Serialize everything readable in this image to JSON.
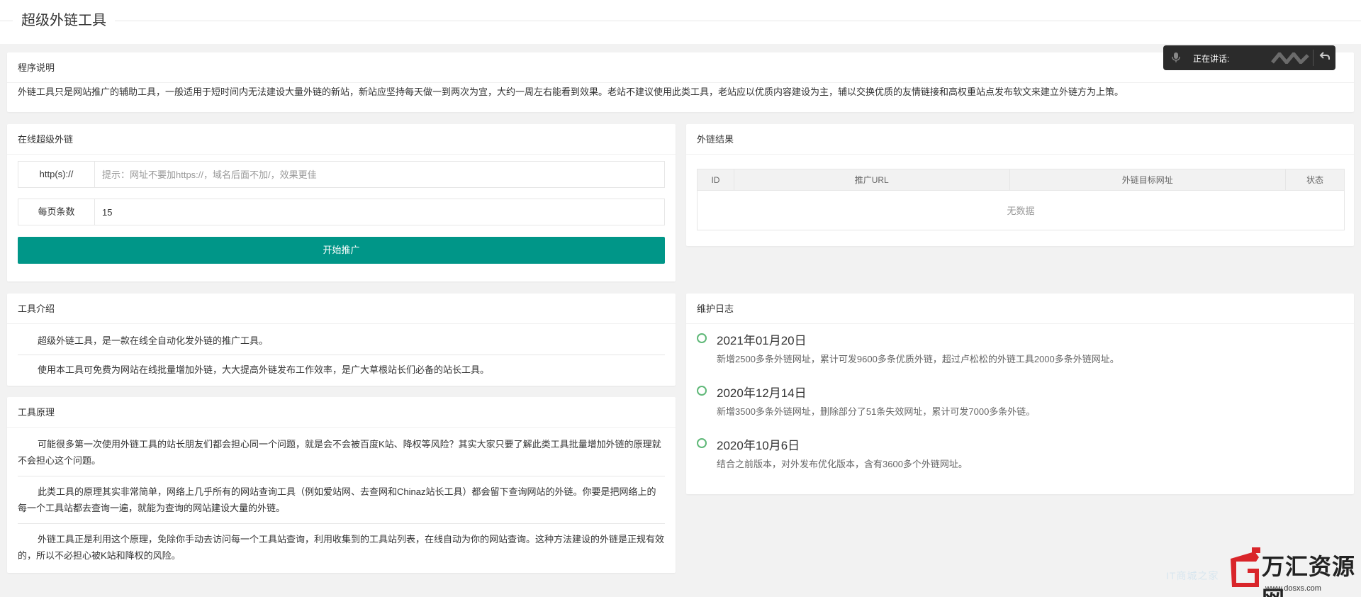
{
  "header": {
    "title": "超级外链工具"
  },
  "program_desc": {
    "title": "程序说明",
    "text": "外链工具只是网站推广的辅助工具，一般适用于短时间内无法建设大量外链的新站，新站应坚持每天做一到两次为宜，大约一周左右能看到效果。老站不建议使用此类工具，老站应以优质内容建设为主，辅以交换优质的友情链接和高权重站点发布软文来建立外链方为上策。"
  },
  "online_form": {
    "title": "在线超级外链",
    "url_label": "http(s)://",
    "url_placeholder": "提示：网址不要加https://，域名后面不加/，效果更佳",
    "url_value": "",
    "per_page_label": "每页条数",
    "per_page_value": "15",
    "submit_label": "开始推广",
    "accent_color": "#009688"
  },
  "results": {
    "title": "外链结果",
    "columns": [
      "ID",
      "推广URL",
      "外链目标网址",
      "状态"
    ],
    "empty_text": "无数据"
  },
  "tool_intro": {
    "title": "工具介绍",
    "paragraphs": [
      "超级外链工具，是一款在线全自动化发外链的推广工具。",
      "使用本工具可免费为网站在线批量增加外链，大大提高外链发布工作效率，是广大草根站长们必备的站长工具。"
    ]
  },
  "tool_principle": {
    "title": "工具原理",
    "paragraphs": [
      "可能很多第一次使用外链工具的站长朋友们都会担心同一个问题，就是会不会被百度K站、降权等风险？其实大家只要了解此类工具批量增加外链的原理就不会担心这个问题。",
      "此类工具的原理其实非常简单，网络上几乎所有的网站查询工具（例如爱站网、去查网和Chinaz站长工具）都会留下查询网站的外链。你要是把网络上的每一个工具站都去查询一遍，就能为查询的网站建设大量的外链。",
      "外链工具正是利用这个原理，免除你手动去访问每一个工具站查询，利用收集到的工具站列表，在线自动为你的网站查询。这种方法建设的外链是正规有效的，所以不必担心被K站和降权的风险。"
    ]
  },
  "changelog": {
    "title": "维护日志",
    "dot_color": "#5fb878",
    "entries": [
      {
        "date": "2021年01月20日",
        "text": "新增2500多条外链网址，累计可发9600多条优质外链，超过卢松松的外链工具2000多条外链网址。"
      },
      {
        "date": "2020年12月14日",
        "text": "新增3500多条外链网址，删除部分了51条失效网址，累计可发7000多条外链。"
      },
      {
        "date": "2020年10月6日",
        "text": "结合之前版本，对外发布优化版本，含有3600多个外链网址。"
      }
    ]
  },
  "speaking_bar": {
    "label": "正在讲话:",
    "mic_icon": "mic-icon",
    "back_icon": "return-icon"
  },
  "watermark": {
    "ghost_text": "IT商城之家",
    "name": "万汇资源网",
    "url": "www.dosxs.com",
    "brand_color": "#d9252a"
  }
}
